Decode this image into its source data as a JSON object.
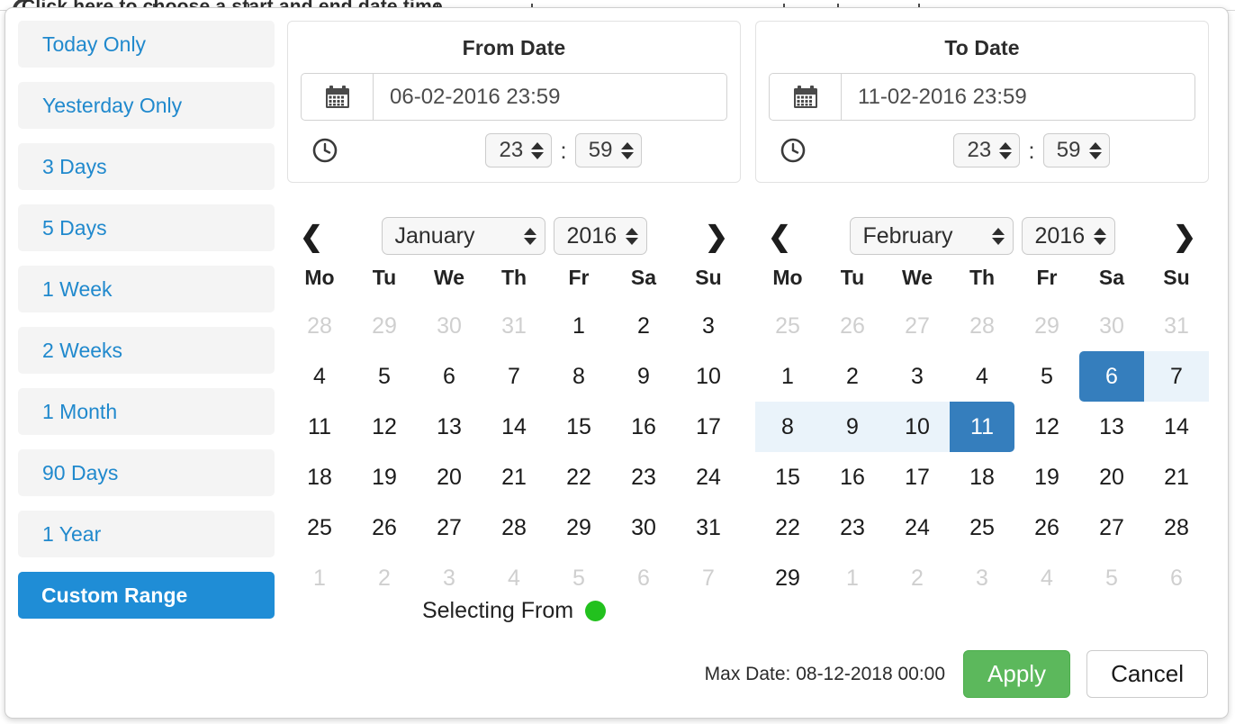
{
  "background": {
    "partial_title": "Click here to choose a start and end date time"
  },
  "ranges": {
    "items": [
      {
        "label": "Today Only",
        "active": false
      },
      {
        "label": "Yesterday Only",
        "active": false
      },
      {
        "label": "3 Days",
        "active": false
      },
      {
        "label": "5 Days",
        "active": false
      },
      {
        "label": "1 Week",
        "active": false
      },
      {
        "label": "2 Weeks",
        "active": false
      },
      {
        "label": "1 Month",
        "active": false
      },
      {
        "label": "90 Days",
        "active": false
      },
      {
        "label": "1 Year",
        "active": false
      },
      {
        "label": "Custom Range",
        "active": true
      }
    ]
  },
  "from_panel": {
    "title": "From Date",
    "date_value": "06-02-2016 23:59",
    "calendar_icon": "calendar-icon",
    "clock_icon": "clock-icon",
    "hour": "23",
    "minute": "59",
    "separator": ":"
  },
  "to_panel": {
    "title": "To Date",
    "date_value": "11-02-2016 23:59",
    "calendar_icon": "calendar-icon",
    "clock_icon": "clock-icon",
    "hour": "23",
    "minute": "59",
    "separator": ":"
  },
  "calendar_left": {
    "prev_icon": "chevron-left-icon",
    "next_icon": "chevron-right-icon",
    "month": "January",
    "year": "2016",
    "dow": [
      "Mo",
      "Tu",
      "We",
      "Th",
      "Fr",
      "Sa",
      "Su"
    ],
    "weeks": [
      [
        {
          "d": "28",
          "s": "muted"
        },
        {
          "d": "29",
          "s": "muted"
        },
        {
          "d": "30",
          "s": "muted"
        },
        {
          "d": "31",
          "s": "muted"
        },
        {
          "d": "1",
          "s": ""
        },
        {
          "d": "2",
          "s": ""
        },
        {
          "d": "3",
          "s": ""
        }
      ],
      [
        {
          "d": "4",
          "s": ""
        },
        {
          "d": "5",
          "s": ""
        },
        {
          "d": "6",
          "s": ""
        },
        {
          "d": "7",
          "s": ""
        },
        {
          "d": "8",
          "s": ""
        },
        {
          "d": "9",
          "s": ""
        },
        {
          "d": "10",
          "s": ""
        }
      ],
      [
        {
          "d": "11",
          "s": ""
        },
        {
          "d": "12",
          "s": ""
        },
        {
          "d": "13",
          "s": ""
        },
        {
          "d": "14",
          "s": ""
        },
        {
          "d": "15",
          "s": ""
        },
        {
          "d": "16",
          "s": ""
        },
        {
          "d": "17",
          "s": ""
        }
      ],
      [
        {
          "d": "18",
          "s": ""
        },
        {
          "d": "19",
          "s": ""
        },
        {
          "d": "20",
          "s": ""
        },
        {
          "d": "21",
          "s": ""
        },
        {
          "d": "22",
          "s": ""
        },
        {
          "d": "23",
          "s": ""
        },
        {
          "d": "24",
          "s": ""
        }
      ],
      [
        {
          "d": "25",
          "s": ""
        },
        {
          "d": "26",
          "s": ""
        },
        {
          "d": "27",
          "s": ""
        },
        {
          "d": "28",
          "s": ""
        },
        {
          "d": "29",
          "s": ""
        },
        {
          "d": "30",
          "s": ""
        },
        {
          "d": "31",
          "s": ""
        }
      ],
      [
        {
          "d": "1",
          "s": "muted"
        },
        {
          "d": "2",
          "s": "muted"
        },
        {
          "d": "3",
          "s": "muted"
        },
        {
          "d": "4",
          "s": "muted"
        },
        {
          "d": "5",
          "s": "muted"
        },
        {
          "d": "6",
          "s": "muted"
        },
        {
          "d": "7",
          "s": "muted"
        }
      ]
    ]
  },
  "calendar_right": {
    "prev_icon": "chevron-left-icon",
    "next_icon": "chevron-right-icon",
    "month": "February",
    "year": "2016",
    "dow": [
      "Mo",
      "Tu",
      "We",
      "Th",
      "Fr",
      "Sa",
      "Su"
    ],
    "weeks": [
      [
        {
          "d": "25",
          "s": "muted"
        },
        {
          "d": "26",
          "s": "muted"
        },
        {
          "d": "27",
          "s": "muted"
        },
        {
          "d": "28",
          "s": "muted"
        },
        {
          "d": "29",
          "s": "muted"
        },
        {
          "d": "30",
          "s": "muted"
        },
        {
          "d": "31",
          "s": "muted"
        }
      ],
      [
        {
          "d": "1",
          "s": ""
        },
        {
          "d": "2",
          "s": ""
        },
        {
          "d": "3",
          "s": ""
        },
        {
          "d": "4",
          "s": ""
        },
        {
          "d": "5",
          "s": ""
        },
        {
          "d": "6",
          "s": "range-start"
        },
        {
          "d": "7",
          "s": "in-range"
        }
      ],
      [
        {
          "d": "8",
          "s": "in-range"
        },
        {
          "d": "9",
          "s": "in-range"
        },
        {
          "d": "10",
          "s": "in-range"
        },
        {
          "d": "11",
          "s": "range-end"
        },
        {
          "d": "12",
          "s": ""
        },
        {
          "d": "13",
          "s": ""
        },
        {
          "d": "14",
          "s": ""
        }
      ],
      [
        {
          "d": "15",
          "s": ""
        },
        {
          "d": "16",
          "s": ""
        },
        {
          "d": "17",
          "s": ""
        },
        {
          "d": "18",
          "s": ""
        },
        {
          "d": "19",
          "s": ""
        },
        {
          "d": "20",
          "s": ""
        },
        {
          "d": "21",
          "s": ""
        }
      ],
      [
        {
          "d": "22",
          "s": ""
        },
        {
          "d": "23",
          "s": ""
        },
        {
          "d": "24",
          "s": ""
        },
        {
          "d": "25",
          "s": ""
        },
        {
          "d": "26",
          "s": ""
        },
        {
          "d": "27",
          "s": ""
        },
        {
          "d": "28",
          "s": ""
        }
      ],
      [
        {
          "d": "29",
          "s": ""
        },
        {
          "d": "1",
          "s": "muted"
        },
        {
          "d": "2",
          "s": "muted"
        },
        {
          "d": "3",
          "s": "muted"
        },
        {
          "d": "4",
          "s": "muted"
        },
        {
          "d": "5",
          "s": "muted"
        },
        {
          "d": "6",
          "s": "muted"
        }
      ]
    ]
  },
  "selecting": {
    "label": "Selecting From",
    "indicator_color": "#22c11e"
  },
  "footer": {
    "max_date_label": "Max Date: 08-12-2018 00:00",
    "apply_label": "Apply",
    "cancel_label": "Cancel"
  },
  "colors": {
    "accent_blue": "#1f8dd6",
    "selected_blue": "#357ebd",
    "in_range_blue": "#eaf3fa",
    "apply_green": "#5cb85c",
    "link_blue": "#2089cd"
  }
}
